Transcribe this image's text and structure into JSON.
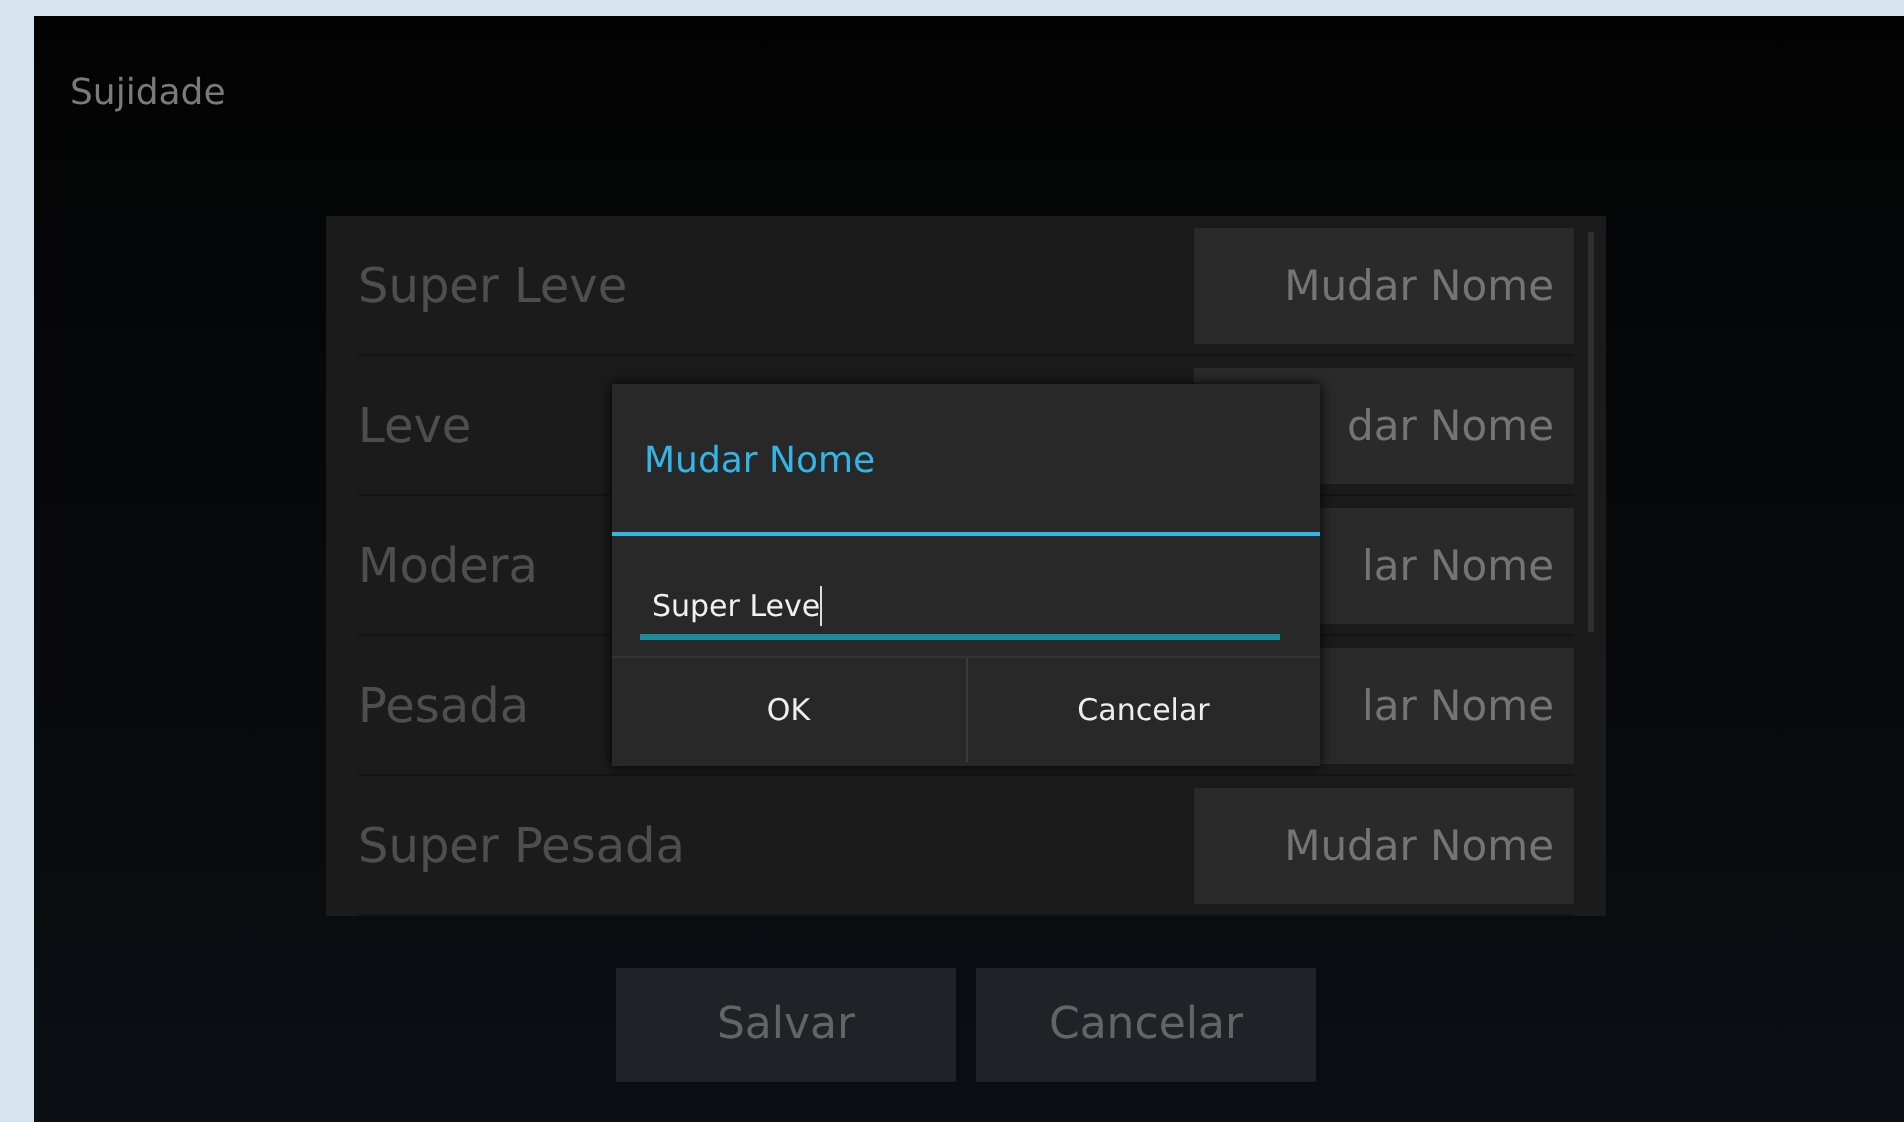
{
  "screen": {
    "title": "Sujidade"
  },
  "rows": [
    {
      "name": "Super Leve",
      "button": "Mudar Nome"
    },
    {
      "name": "Leve",
      "button": "dar Nome"
    },
    {
      "name": "Modera",
      "button": "lar Nome"
    },
    {
      "name": "Pesada",
      "button": "lar Nome"
    },
    {
      "name": "Super Pesada",
      "button": "Mudar Nome"
    }
  ],
  "dialog": {
    "title": "Mudar Nome",
    "value": "Super Leve",
    "buttons": [
      "OK",
      "Cancelar"
    ]
  },
  "buttons": [
    "Salvar",
    "Cancelar"
  ]
}
